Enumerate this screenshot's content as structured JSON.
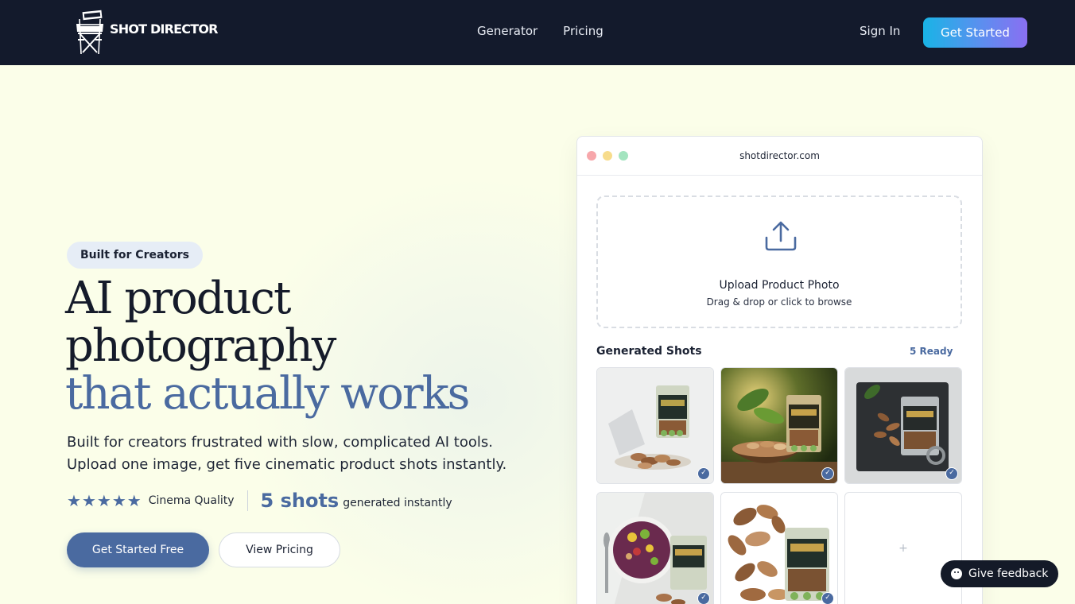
{
  "nav": {
    "brand": "SHOT DIRECTOR",
    "links": [
      "Generator",
      "Pricing"
    ],
    "sign_in": "Sign In",
    "cta": "Get Started"
  },
  "hero": {
    "badge": "Built for Creators",
    "headline_line1": "AI product",
    "headline_line2": "photography",
    "headline_accent": "that actually works",
    "sub_line1": "Built for creators frustrated with slow, complicated AI tools.",
    "sub_line2": "Upload one image, get five cinematic product shots instantly.",
    "rating_stars": 5,
    "rating_label": "Cinema Quality",
    "shots_count": "5 shots",
    "shots_label": "generated instantly",
    "primary_cta": "Get Started Free",
    "secondary_cta": "View Pricing"
  },
  "browser": {
    "url": "shotdirector.com",
    "upload_title": "Upload Product Photo",
    "upload_hint": "Drag & drop or click to browse",
    "generated_title": "Generated Shots",
    "ready_label": "5 Ready",
    "shots": [
      {
        "name": "shot-white-studio",
        "status": "ready"
      },
      {
        "name": "shot-jungle-bowl",
        "status": "ready"
      },
      {
        "name": "shot-slate-tray",
        "status": "ready"
      },
      {
        "name": "shot-acai-bowl",
        "status": "ready"
      },
      {
        "name": "shot-nut-pile",
        "status": "ready"
      },
      {
        "name": "shot-empty-slot",
        "status": "empty",
        "label": "+"
      }
    ]
  },
  "feedback": {
    "label": "Give feedback"
  },
  "colors": {
    "nav_bg": "#131a2c",
    "page_bg": "#fbfee9",
    "accent": "#4a6aa0",
    "cta_gradient_start": "#19b4e6",
    "cta_gradient_end": "#8a6ff2"
  }
}
